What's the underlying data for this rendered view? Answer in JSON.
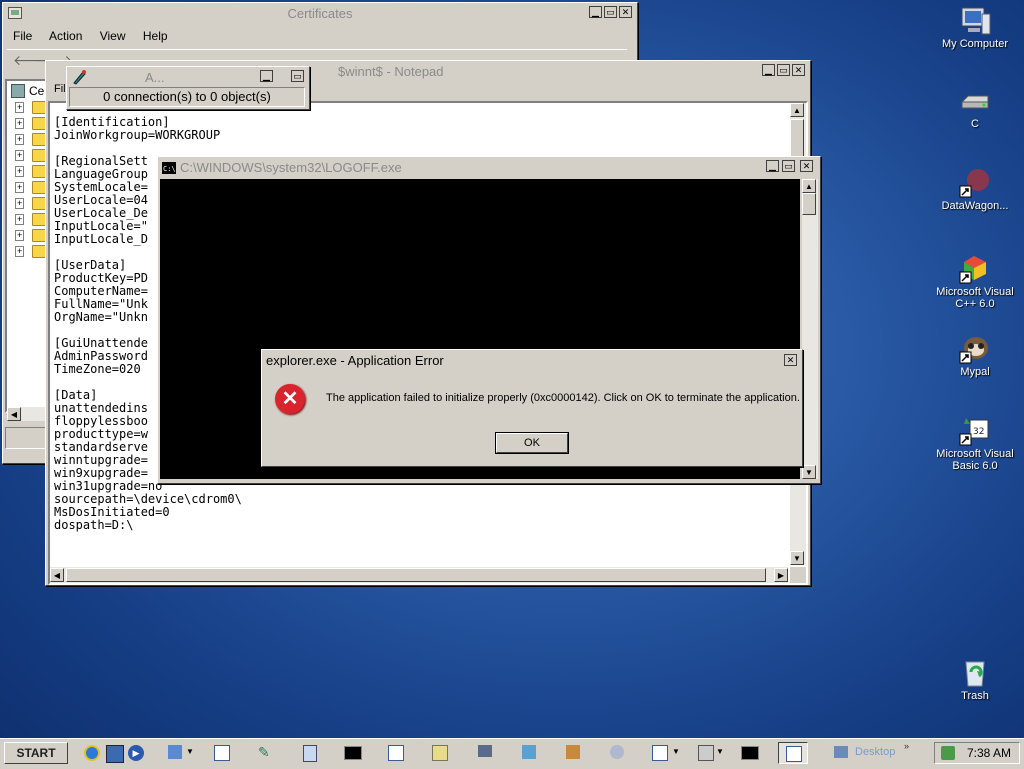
{
  "certificates": {
    "title": "Certificates",
    "menu": [
      "File",
      "Action",
      "View",
      "Help"
    ],
    "tree_root": "Ce"
  },
  "notepad": {
    "title": "$winnt$ - Notepad",
    "menu_partial": "File",
    "lines": [
      "[Identification]",
      "JoinWorkgroup=WORKGROUP",
      "",
      "[RegionalSett",
      "LanguageGroup",
      "SystemLocale=",
      "UserLocale=04",
      "UserLocale_De",
      "InputLocale=\"",
      "InputLocale_D",
      "",
      "[UserData]",
      "ProductKey=PD",
      "ComputerName=",
      "FullName=\"Unk",
      "OrgName=\"Unkn",
      "",
      "[GuiUnattende",
      "AdminPassword",
      "TimeZone=020",
      "",
      "[Data]",
      "unattendedins",
      "floppylessboo",
      "producttype=w",
      "standardserve",
      "winntupgrade=",
      "win9xupgrade=",
      "win31upgrade=no",
      "sourcepath=\\device\\cdrom0\\",
      "MsDosInitiated=0",
      "dospath=D:\\"
    ]
  },
  "small_window": {
    "title": "A...",
    "status": "0 connection(s) to 0 object(s)"
  },
  "console": {
    "title": "C:\\WINDOWS\\system32\\LOGOFF.exe"
  },
  "dialog": {
    "title": "explorer.exe - Application Error",
    "message": "The application failed to initialize properly (0xc0000142). Click on OK to terminate the application.",
    "ok_label": "OK",
    "close_glyph": "✕"
  },
  "desktop_icons": [
    {
      "label": "My Computer",
      "icon": "my-computer-icon"
    },
    {
      "label": "C",
      "icon": "drive-icon"
    },
    {
      "label": "DataWagon...",
      "icon": "datawagon-icon"
    },
    {
      "label": "Microsoft Visual C++ 6.0",
      "icon": "visual-cpp-icon"
    },
    {
      "label": "Mypal",
      "icon": "mypal-icon"
    },
    {
      "label": "Microsoft Visual Basic 6.0",
      "icon": "visual-basic-icon"
    },
    {
      "label": "Trash",
      "icon": "trash-icon"
    }
  ],
  "taskbar": {
    "start_label": "START",
    "desktop_label": "Desktop",
    "clock": "7:38 AM"
  },
  "colors": {
    "error_red": "#d9232d",
    "console_bg": "#000000",
    "desktop_blue": "#2a5aa6"
  }
}
